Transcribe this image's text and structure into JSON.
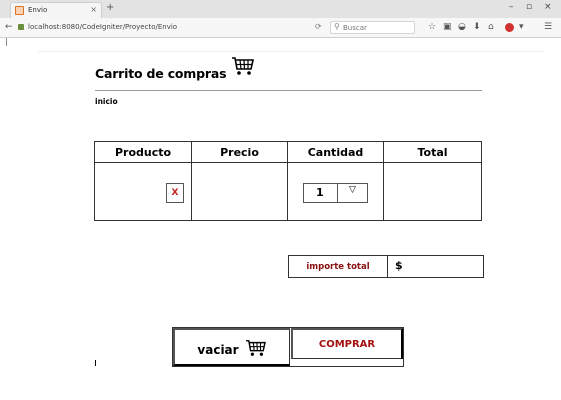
{
  "browser": {
    "tab_title": "Envio",
    "tab_close": "×",
    "new_tab": "+",
    "url": "localhost:8080/CodeIgniter/Proyecto/Envio",
    "search_placeholder": "Buscar",
    "window_controls": [
      "–",
      "▫",
      "×"
    ],
    "toolbar_icons": [
      "star-icon",
      "bookmarks-icon",
      "pocket-icon",
      "downloads-icon",
      "home-icon",
      "chat-icon",
      "adblock-icon",
      "menu-icon"
    ]
  },
  "page": {
    "title": "Carrito de compras",
    "nav_link": "inicio"
  },
  "cart": {
    "columns": [
      "Producto",
      "Precio",
      "Cantidad",
      "Total"
    ],
    "rows": [
      {
        "remove_label": "X",
        "price": "",
        "quantity": "1",
        "quantity_arrow": "▽",
        "total": ""
      }
    ]
  },
  "summary": {
    "total_label": "importe total",
    "total_value": "$"
  },
  "actions": {
    "vaciar_label": "vaciar",
    "comprar_label": "COMPRAR"
  },
  "colors": {
    "accent_red": "#a41010",
    "remove_red": "#c0251b"
  }
}
